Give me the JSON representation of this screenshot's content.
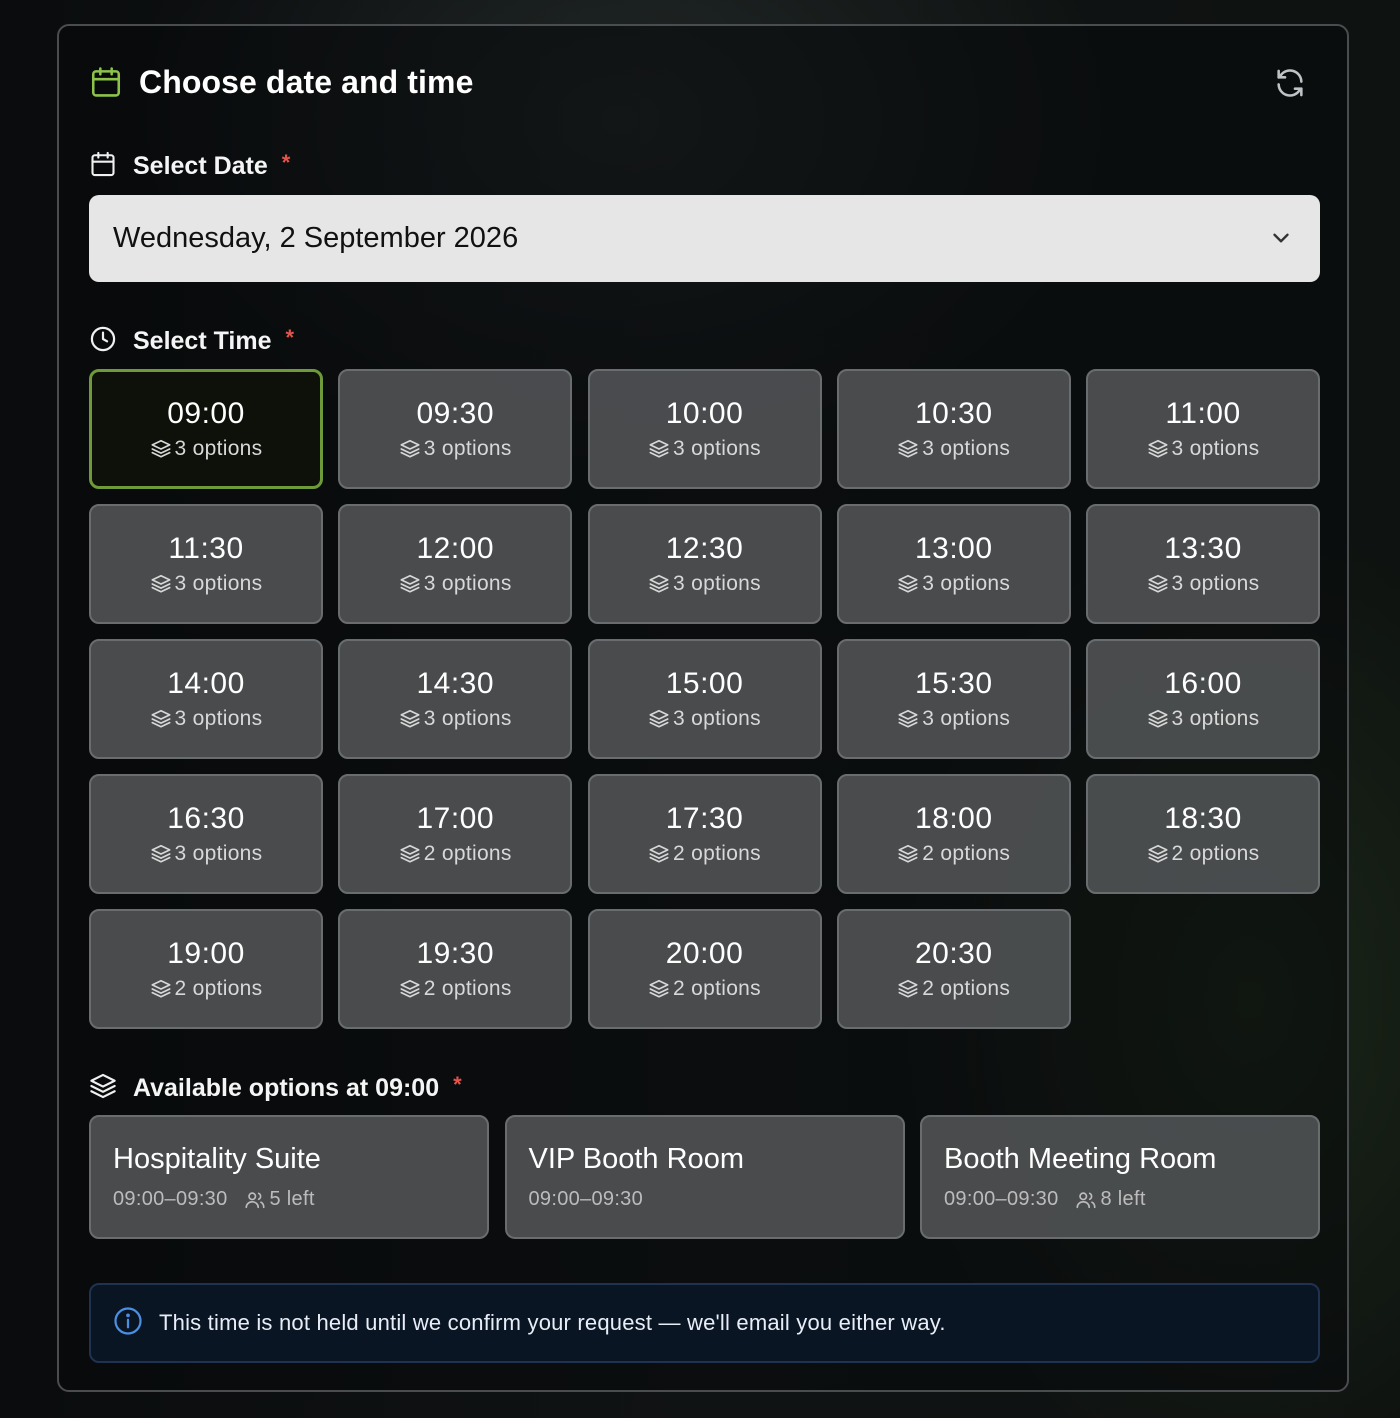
{
  "header": {
    "title": "Choose date and time",
    "icon": "calendar-icon",
    "accent": "#8dc34a"
  },
  "date": {
    "label": "Select Date",
    "required_mark": "*",
    "value": "Wednesday, 2 September 2026"
  },
  "time": {
    "label": "Select Time",
    "required_mark": "*",
    "selected": "09:00",
    "slots": [
      {
        "time": "09:00",
        "options": "3 options"
      },
      {
        "time": "09:30",
        "options": "3 options"
      },
      {
        "time": "10:00",
        "options": "3 options"
      },
      {
        "time": "10:30",
        "options": "3 options"
      },
      {
        "time": "11:00",
        "options": "3 options"
      },
      {
        "time": "11:30",
        "options": "3 options"
      },
      {
        "time": "12:00",
        "options": "3 options"
      },
      {
        "time": "12:30",
        "options": "3 options"
      },
      {
        "time": "13:00",
        "options": "3 options"
      },
      {
        "time": "13:30",
        "options": "3 options"
      },
      {
        "time": "14:00",
        "options": "3 options"
      },
      {
        "time": "14:30",
        "options": "3 options"
      },
      {
        "time": "15:00",
        "options": "3 options"
      },
      {
        "time": "15:30",
        "options": "3 options"
      },
      {
        "time": "16:00",
        "options": "3 options"
      },
      {
        "time": "16:30",
        "options": "3 options"
      },
      {
        "time": "17:00",
        "options": "2 options"
      },
      {
        "time": "17:30",
        "options": "2 options"
      },
      {
        "time": "18:00",
        "options": "2 options"
      },
      {
        "time": "18:30",
        "options": "2 options"
      },
      {
        "time": "19:00",
        "options": "2 options"
      },
      {
        "time": "19:30",
        "options": "2 options"
      },
      {
        "time": "20:00",
        "options": "2 options"
      },
      {
        "time": "20:30",
        "options": "2 options"
      }
    ]
  },
  "options": {
    "label": "Available options at 09:00",
    "required_mark": "*",
    "items": [
      {
        "name": "Hospitality Suite",
        "range": "09:00–09:30",
        "left": "5 left"
      },
      {
        "name": "VIP Booth Room",
        "range": "09:00–09:30",
        "left": ""
      },
      {
        "name": "Booth Meeting Room",
        "range": "09:00–09:30",
        "left": "8 left"
      }
    ]
  },
  "notice": {
    "text": "This time is not held until we confirm your request — we'll email you either way.",
    "icon": "info-icon"
  },
  "colors": {
    "selected_border": "#6f9a3a",
    "required": "#e5534b",
    "notice_bg": "#0a1524"
  }
}
